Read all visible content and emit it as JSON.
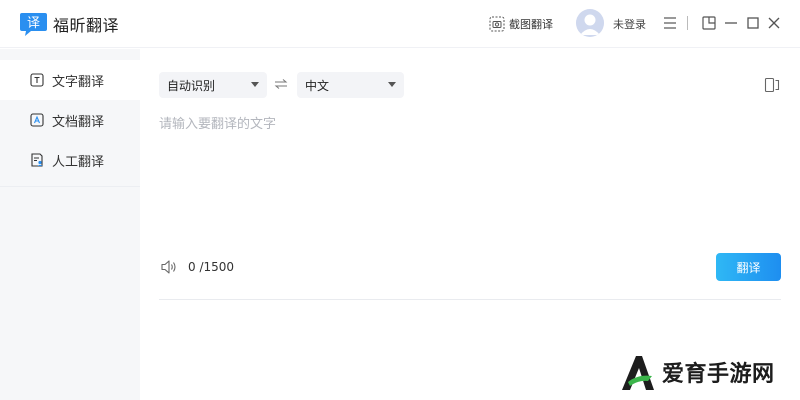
{
  "app": {
    "title": "福昕翻译",
    "logo_glyph": "译"
  },
  "titlebar": {
    "screenshot_label": "截图翻译",
    "login_label": "未登录",
    "icons": [
      "camera-icon",
      "avatar",
      "menu-icon",
      "pin-icon",
      "minimize-icon",
      "maximize-icon",
      "close-icon"
    ]
  },
  "sidebar": {
    "items": [
      {
        "label": "文字翻译",
        "icon": "text-translate-icon",
        "active": true
      },
      {
        "label": "文档翻译",
        "icon": "document-translate-icon",
        "active": false
      },
      {
        "label": "人工翻译",
        "icon": "human-translate-icon",
        "active": false
      }
    ]
  },
  "main": {
    "source_lang": "自动识别",
    "target_lang": "中文",
    "input_placeholder": "请输入要翻译的文字",
    "input_value": "",
    "char_count": "0 /1500",
    "translate_label": "翻译"
  },
  "watermark": {
    "text": "爱育手游网"
  },
  "colors": {
    "accent": "#1e8ef0",
    "sidebar_bg": "#f6f7f9",
    "logo_bg": "#2a8ff0"
  }
}
